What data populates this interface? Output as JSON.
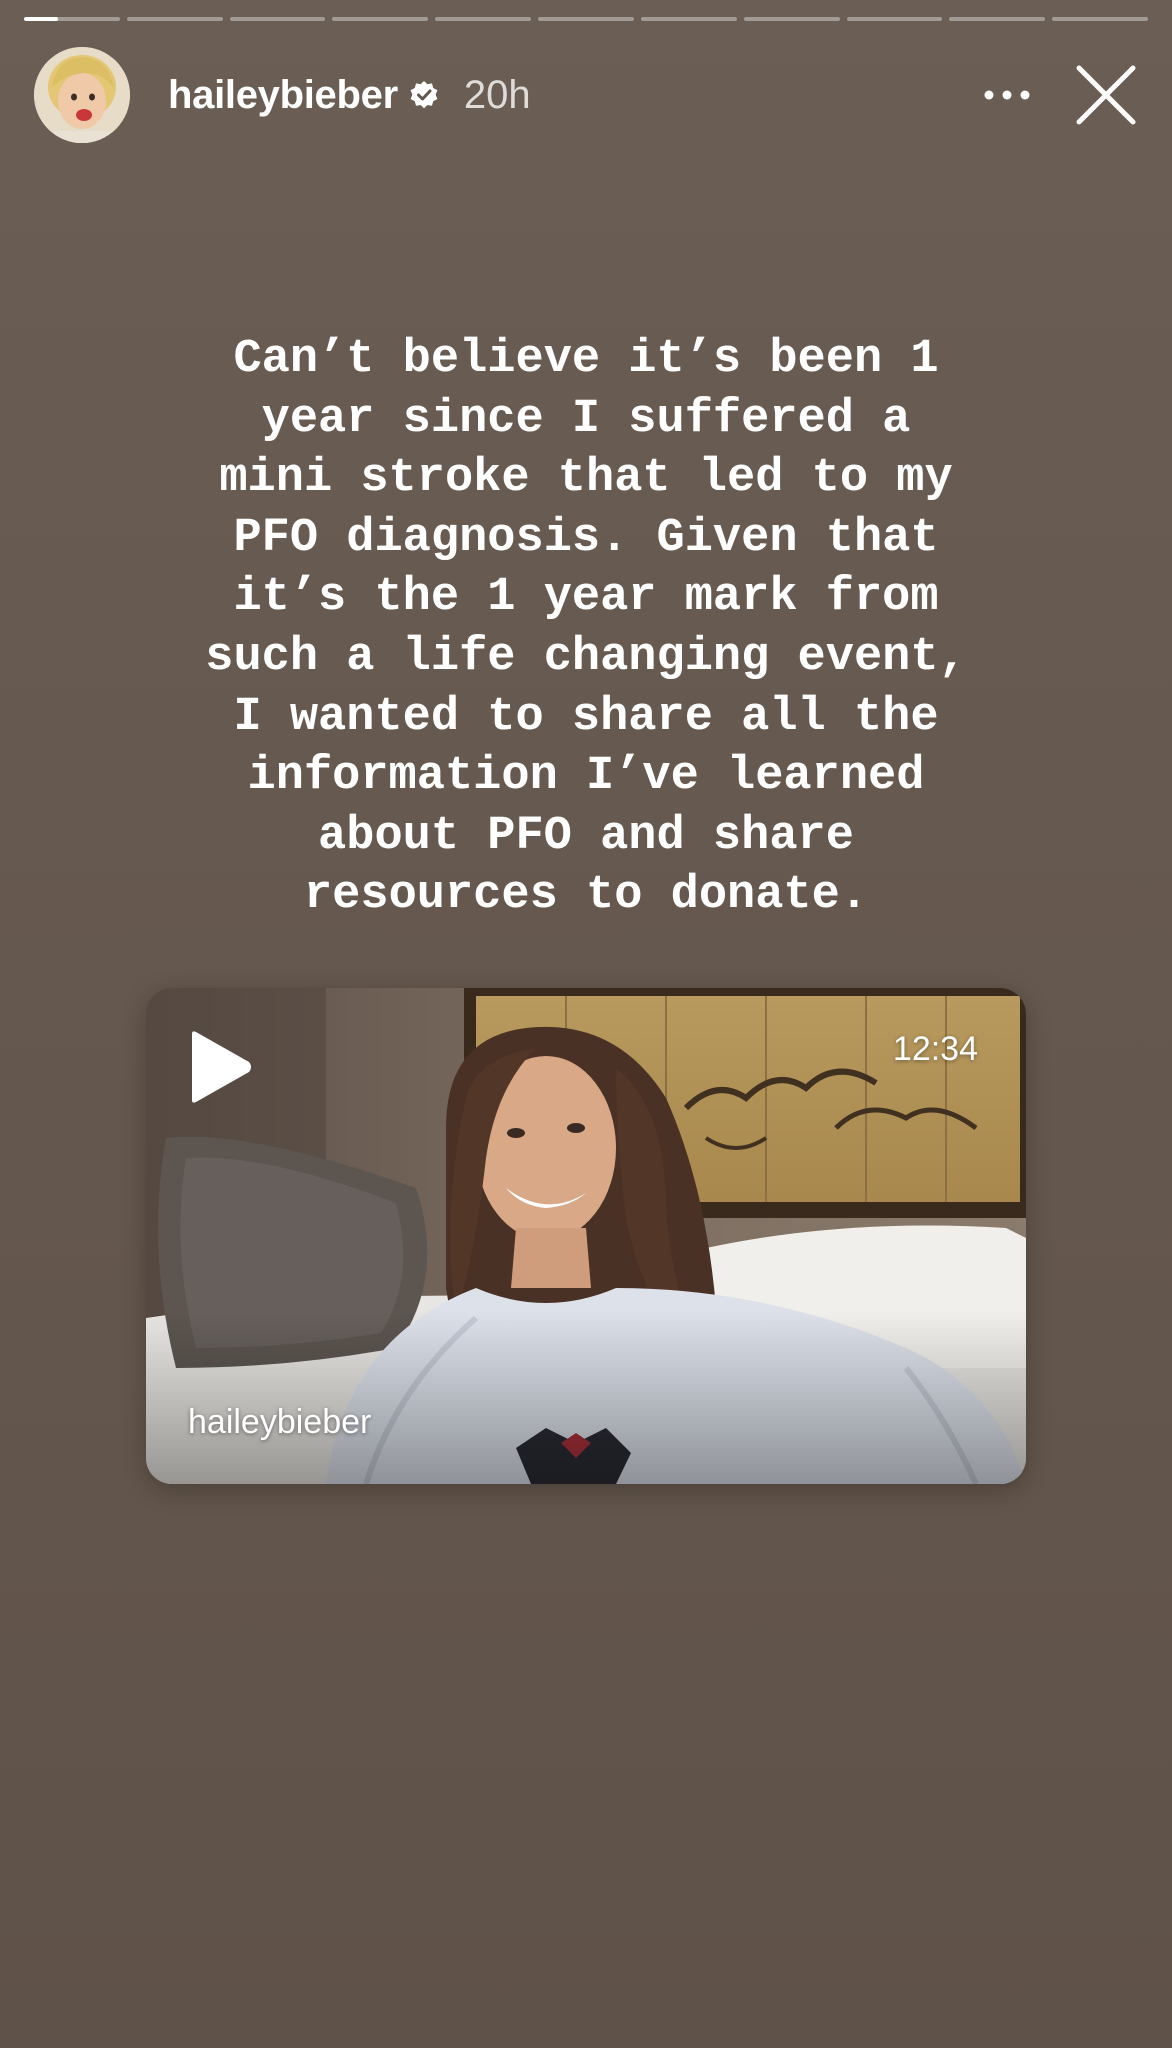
{
  "story": {
    "progress": {
      "segments": 11,
      "active_index": 0,
      "active_fill": 0.35
    },
    "header": {
      "username": "haileybieber",
      "verified": true,
      "timestamp": "20h",
      "avatar_icon": "profile-avatar",
      "more_icon": "more-horizontal-icon",
      "close_icon": "close-icon"
    },
    "caption": "Can’t believe it’s been 1\nyear since I suffered a\nmini stroke that led to my\nPFO diagnosis. Given that\nit’s the 1 year mark from\nsuch a life changing event,\nI wanted to share all the\ninformation I’ve learned\nabout PFO and share\nresources to donate.",
    "video": {
      "duration": "12:34",
      "author": "haileybieber",
      "play_icon": "play-icon"
    },
    "colors": {
      "background": "#62554b",
      "text": "#ffffff"
    }
  }
}
